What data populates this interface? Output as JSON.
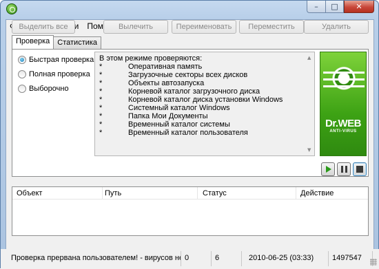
{
  "window": {
    "title": "",
    "caption_buttons": {
      "minimize": "–",
      "maximize": "□",
      "close": "✕"
    },
    "accent_color": "#3da214"
  },
  "menu": [
    "Файл",
    "Настройки",
    "Помощь"
  ],
  "tabs": [
    {
      "label": "Проверка",
      "active": true
    },
    {
      "label": "Статистика",
      "active": false
    }
  ],
  "scan_modes": [
    {
      "label": "Быстрая проверка",
      "selected": true
    },
    {
      "label": "Полная проверка",
      "selected": false
    },
    {
      "label": "Выборочно",
      "selected": false
    }
  ],
  "description": {
    "header": "В этом режиме проверяются:",
    "bullet": "*",
    "items": [
      "Оперативная память",
      "Загрузочные секторы всех дисков",
      "Объекты автозапуска",
      "Корневой каталог загрузочного диска",
      "Корневой каталог диска установки Windows",
      "Системный каталог Windows",
      "Папка Мои Документы",
      "Временный каталог системы",
      "Временный каталог пользователя"
    ]
  },
  "logo": {
    "title": "Dr.WEB",
    "subtitle": "ANTI-VIRUS"
  },
  "controls": {
    "play": "play-icon",
    "pause": "pause-icon",
    "stop": "stop-icon"
  },
  "results": {
    "columns": [
      "Объект",
      "Путь",
      "Статус",
      "Действие"
    ],
    "rows": []
  },
  "actions": [
    "Выделить все",
    "Вылечить",
    "Переименовать",
    "Переместить",
    "Удалить"
  ],
  "progress": 0,
  "status": {
    "message": "Проверка прервана пользователем! - вирусов не",
    "viruses": "0",
    "count": "6",
    "datetime": "2010-06-25 (03:33)",
    "records": "1497547"
  }
}
